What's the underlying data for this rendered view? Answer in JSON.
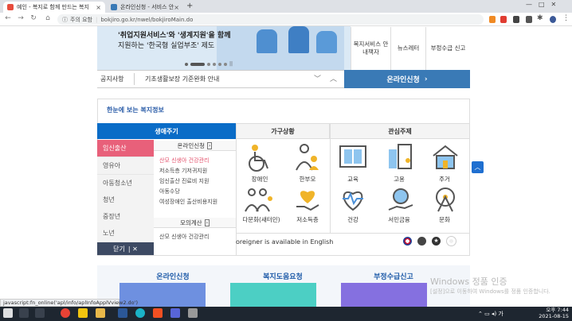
{
  "browser": {
    "tabs": [
      {
        "label": "예인 - 복지로 함께 만드는 복지",
        "active": true
      },
      {
        "label": "온라인신청 - 서비스 안내 - 신..",
        "active": false
      }
    ],
    "new_tab": "+",
    "address_prefix": "주의 요함",
    "url": "bokjiro.go.kr/nwel/bokjiroMain.do",
    "status_url": "javascript:fn_online('apl/info/aplInfoApplVview2.do')"
  },
  "hero": {
    "line1": "'취업지원서비스'와 '생계지원'을 함께",
    "line2": "지원하는 '한국형 실업부조' 제도"
  },
  "top_nav": [
    {
      "label": "복지서비스 안내책자"
    },
    {
      "label": "뉴스레터"
    },
    {
      "label": "부정수급 신고"
    }
  ],
  "notice": {
    "label": "공지사항",
    "text": "기초생활보장 기준완화 안내"
  },
  "online_apply": "온라인신청",
  "welfare_section": {
    "title": "한눈에 보는 복지정보",
    "tabs": [
      "생애주기",
      "가구상황",
      "관심주제"
    ],
    "life_items": [
      "임신출산",
      "영유아",
      "아동청소년",
      "청년",
      "중장년",
      "노년"
    ],
    "close_label": "닫기",
    "online_header": "온라인신청",
    "online_links": [
      "산모 신생아 건강관리",
      "저소득층 기저귀지원",
      "임신출산 진료비 지원",
      "아동수당",
      "여성장애인 출산비용지원"
    ],
    "mock_header": "모의계산",
    "mock_links": [
      "산모 신생아 건강관리"
    ],
    "family_items": [
      "장애인",
      "한부모",
      "다문화(새터민)",
      "저소득층"
    ],
    "interest_items": [
      "교육",
      "고용",
      "주거",
      "건강",
      "서민금융",
      "문화"
    ],
    "foreigner_text": "oreigner is available in English"
  },
  "bottom_links": [
    "온라인신청",
    "복지도움요청",
    "부정수급신고"
  ],
  "watermark": {
    "title": "Windows 정품 인증",
    "sub": "[설정]으로 이동하여 Windows를 정품 인증합니다."
  },
  "clock": {
    "time": "오후 7:44",
    "date": "2021-08-15"
  },
  "colors": {
    "primary": "#0a6cc7",
    "accent": "#e8607a",
    "apply": "#3a7ab6"
  }
}
